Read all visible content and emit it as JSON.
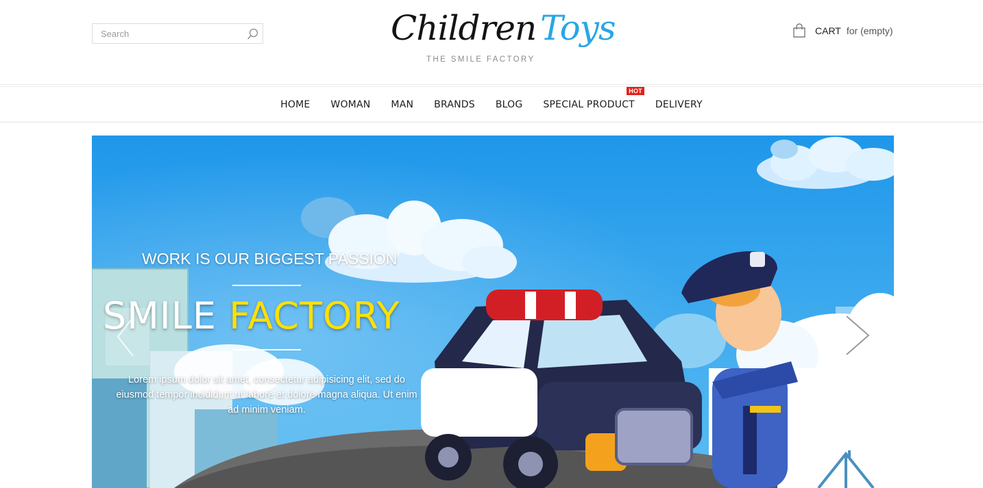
{
  "search": {
    "placeholder": "Search",
    "icon": "search-icon"
  },
  "logo": {
    "word1": "Children",
    "word2": "Toys",
    "tagline": "THE SMILE FACTORY",
    "accent_color": "#29a6e6"
  },
  "cart": {
    "label": "CART",
    "status": "for (empty)",
    "icon": "shopping-bag-icon"
  },
  "nav": {
    "items": [
      {
        "label": "HOME"
      },
      {
        "label": "WOMAN"
      },
      {
        "label": "MAN"
      },
      {
        "label": "BRANDS"
      },
      {
        "label": "BLOG"
      },
      {
        "label": "SPECIAL PRODUCT",
        "badge": "HOT"
      },
      {
        "label": "DELIVERY"
      }
    ],
    "badge_color": "#e2231a"
  },
  "slider": {
    "subtitle": "WORK IS OUR BIGGEST PASSION",
    "title_part1": "SMILE",
    "title_part2": "FACTORY",
    "title_accent_color": "#ffe000",
    "text": "Lorem ipsum dolor sit amet, consectetur adipisicing elit, sed do eiusmod tempor incididunt ut labore et dolore magna aliqua. Ut enim ad minim veniam.",
    "background_color": "#2f9fe8",
    "prev_icon": "chevron-left-icon",
    "next_icon": "chevron-right-icon"
  }
}
